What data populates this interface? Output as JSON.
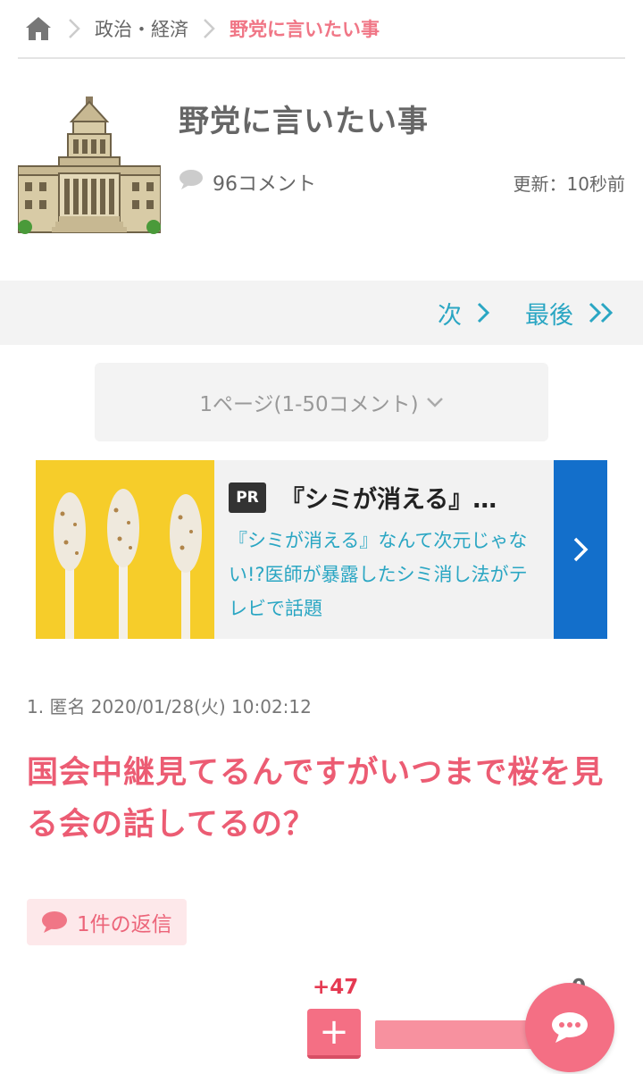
{
  "breadcrumb": {
    "category": "政治・経済",
    "current": "野党に言いたい事"
  },
  "topic": {
    "title": "野党に言いたい事",
    "comment_count": "96コメント",
    "updated": "更新：10秒前"
  },
  "pager": {
    "next_label": "次",
    "last_label": "最後",
    "page_select": "1ページ(1-50コメント)"
  },
  "ad": {
    "badge": "PR",
    "title": "『シミが消える』…",
    "description": "『シミが消える』なんて次元じゃない!?医師が暴露したシミ消し法がテレビで話題"
  },
  "comment": {
    "meta": "1. 匿名 2020/01/28(火) 10:02:12",
    "body": "国会中継見てるんですがいつまで桜を見る会の話してるの？",
    "reply_label": "1件の返信",
    "plus_count": "+47",
    "minus_count": "0",
    "plus_symbol": "+"
  },
  "colors": {
    "accent_pink": "#ec5c73",
    "link_teal": "#2aa6c3",
    "ad_blue": "#136fcb"
  },
  "icons": [
    "home-icon",
    "chevron-right-icon",
    "speech-bubble-icon",
    "chevron-down-icon",
    "double-chevron-right-icon",
    "chat-icon"
  ]
}
